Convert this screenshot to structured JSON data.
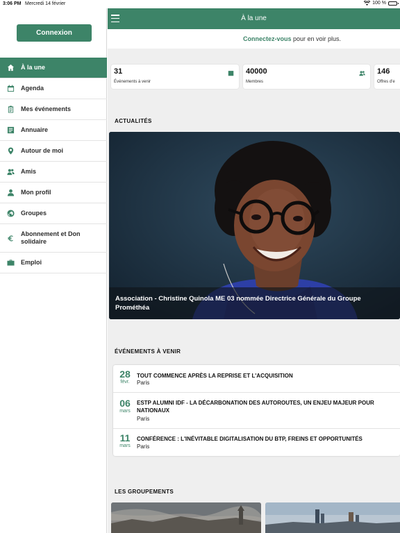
{
  "status_bar": {
    "time": "3:06 PM",
    "date": "Mercredi 14 février",
    "battery": "100 %",
    "battery_level": 1.0
  },
  "colors": {
    "accent": "#3d8468",
    "background": "#efefef"
  },
  "sidebar": {
    "login_label": "Connexion",
    "items": [
      {
        "label": "À la une",
        "icon": "home-icon",
        "active": true
      },
      {
        "label": "Agenda",
        "icon": "calendar-icon"
      },
      {
        "label": "Mes événements",
        "icon": "clipboard-icon"
      },
      {
        "label": "Annuaire",
        "icon": "directory-icon"
      },
      {
        "label": "Autour de moi",
        "icon": "location-pin-icon"
      },
      {
        "label": "Amis",
        "icon": "friends-icon"
      },
      {
        "label": "Mon profil",
        "icon": "profile-icon"
      },
      {
        "label": "Groupes",
        "icon": "globe-icon"
      },
      {
        "label": "Abonnement et Don solidaire",
        "icon": "euro-icon"
      },
      {
        "label": "Emploi",
        "icon": "briefcase-icon"
      }
    ]
  },
  "header": {
    "title": "À la une",
    "menu_icon": "hamburger-icon"
  },
  "connect_bar": {
    "link": "Connectez-vous",
    "text": " pour en voir plus."
  },
  "stats": [
    {
      "value": "31",
      "label": "Événements à venir",
      "icon": "calendar-icon"
    },
    {
      "value": "40000",
      "label": "Membres",
      "icon": "members-icon"
    },
    {
      "value": "146",
      "label": "Offres d'e"
    }
  ],
  "news": {
    "section_title": "ACTUALITÉS",
    "caption": "Association - Christine Quinola ME 03 nommée Directrice Générale du Groupe Prométhéa"
  },
  "events": {
    "section_title": "ÉVÉNEMENTS À VENIR",
    "items": [
      {
        "day": "28",
        "month": "févr.",
        "title": "TOUT COMMENCE APRÈS LA REPRISE ET L'ACQUISITION",
        "location": "Paris"
      },
      {
        "day": "06",
        "month": "mars",
        "title": "ESTP ALUMNI IDF - LA DÉCARBONATION DES AUTOROUTES, UN ENJEU MAJEUR POUR NATIONAUX",
        "location": "Paris"
      },
      {
        "day": "11",
        "month": "mars",
        "title": "CONFÉRENCE : L'INÉVITABLE DIGITALISATION DU BTP, FREINS ET OPPORTUNITÉS",
        "location": "Paris"
      }
    ]
  },
  "groups": {
    "section_title": "LES GROUPEMENTS"
  }
}
